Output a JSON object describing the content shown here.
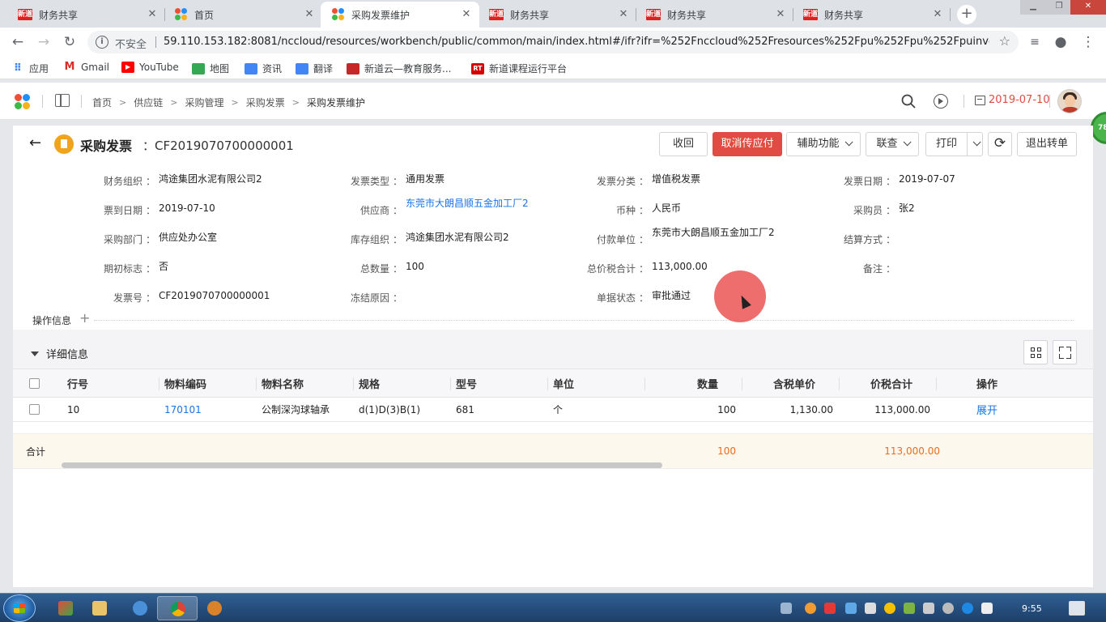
{
  "browser": {
    "tabs": [
      {
        "title": "财务共享",
        "favicon": "xindao-icon",
        "active": false
      },
      {
        "title": "首页",
        "favicon": "nccloud-icon",
        "active": false
      },
      {
        "title": "采购发票维护",
        "favicon": "nccloud-icon",
        "active": true
      },
      {
        "title": "财务共享",
        "favicon": "xindao-icon",
        "active": false
      },
      {
        "title": "财务共享",
        "favicon": "xindao-icon",
        "active": false
      },
      {
        "title": "财务共享",
        "favicon": "xindao-icon",
        "active": false
      }
    ],
    "xindao_favicon_text": "新道",
    "security_label": "不安全",
    "url": "59.110.153.182:8081/nccloud/resources/workbench/public/common/main/index.html#/ifr?ifr=%252Fnccloud%252Fresources%252Fpu%252Fpu%252Fpuinvoice%2...",
    "bookmarks": [
      {
        "label": "应用",
        "icon": "apps-icon"
      },
      {
        "label": "Gmail",
        "icon": "gmail-icon"
      },
      {
        "label": "YouTube",
        "icon": "youtube-icon"
      },
      {
        "label": "地图",
        "icon": "maps-icon"
      },
      {
        "label": "资讯",
        "icon": "news-icon"
      },
      {
        "label": "翻译",
        "icon": "translate-icon"
      },
      {
        "label": "新道云—教育服务...",
        "icon": "xindao-cloud-icon"
      },
      {
        "label": "新道课程运行平台",
        "icon": "rt-icon"
      }
    ],
    "rt_icon_text": "RT"
  },
  "app_header": {
    "breadcrumb": [
      "首页",
      "供应链",
      "采购管理",
      "采购发票",
      "采购发票维护"
    ],
    "date": "2019-07-10",
    "side_badge": "78"
  },
  "document": {
    "title": "采购发票",
    "number": "：CF2019070700000001",
    "buttons": {
      "recall": "收回",
      "cancel_payable": "取消传应付",
      "assist": "辅助功能",
      "linked_query": "联查",
      "print": "打印",
      "exit_transfer": "退出转单"
    }
  },
  "form": {
    "colon": "：",
    "rows": [
      [
        {
          "label": "财务组织",
          "value": "鸿途集团水泥有限公司2"
        },
        {
          "label": "发票类型",
          "value": "通用发票"
        },
        {
          "label": "发票分类",
          "value": "增值税发票"
        },
        {
          "label": "发票日期",
          "value": "2019-07-07"
        }
      ],
      [
        {
          "label": "票到日期",
          "value": "2019-07-10"
        },
        {
          "label": "供应商",
          "value": "东莞市大朗昌顺五金加工厂2",
          "link": true
        },
        {
          "label": "币种",
          "value": "人民币"
        },
        {
          "label": "采购员",
          "value": "张2"
        }
      ],
      [
        {
          "label": "采购部门",
          "value": "供应处办公室"
        },
        {
          "label": "库存组织",
          "value": "鸿途集团水泥有限公司2"
        },
        {
          "label": "付款单位",
          "value": "东莞市大朗昌顺五金加工厂2"
        },
        {
          "label": "结算方式",
          "value": ""
        }
      ],
      [
        {
          "label": "期初标志",
          "value": "否"
        },
        {
          "label": "总数量",
          "value": "100"
        },
        {
          "label": "总价税合计",
          "value": "113,000.00"
        },
        {
          "label": "备注",
          "value": ""
        }
      ],
      [
        {
          "label": "发票号",
          "value": "CF2019070700000001"
        },
        {
          "label": "冻结原因",
          "value": ""
        },
        {
          "label": "单据状态",
          "value": "审批通过"
        }
      ]
    ],
    "operation_info": "操作信息",
    "plus": "+"
  },
  "detail": {
    "title": "详细信息",
    "columns": [
      "行号",
      "物料编码",
      "物料名称",
      "规格",
      "型号",
      "单位",
      "数量",
      "含税单价",
      "价税合计",
      "操作"
    ],
    "rows": [
      {
        "line_no": "10",
        "material_code": "170101",
        "material_name": "公制深沟球轴承",
        "spec": "d(1)D(3)B(1)",
        "model": "681",
        "unit": "个",
        "qty": "100",
        "unit_price": "1,130.00",
        "total": "113,000.00",
        "action": "展开"
      }
    ],
    "footer": {
      "label": "合计",
      "qty": "100",
      "total": "113,000.00"
    }
  },
  "taskbar": {
    "clock": "9:55"
  }
}
